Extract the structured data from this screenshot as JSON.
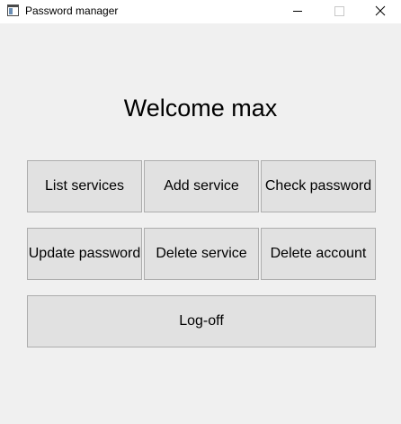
{
  "window": {
    "title": "Password manager",
    "app_icon": "app-window-icon",
    "controls": {
      "minimize_icon": "minimize-icon",
      "maximize_icon": "maximize-icon",
      "close_icon": "close-icon"
    }
  },
  "main": {
    "welcome": "Welcome max",
    "buttons": {
      "list_services": "List services",
      "add_service": "Add service",
      "check_password": "Check password",
      "update_password": "Update password",
      "delete_service": "Delete service",
      "delete_account": "Delete account",
      "log_off": "Log-off"
    }
  },
  "colors": {
    "background": "#f0f0f0",
    "button_face": "#e1e1e1",
    "button_border": "#adadad",
    "titlebar": "#ffffff"
  }
}
